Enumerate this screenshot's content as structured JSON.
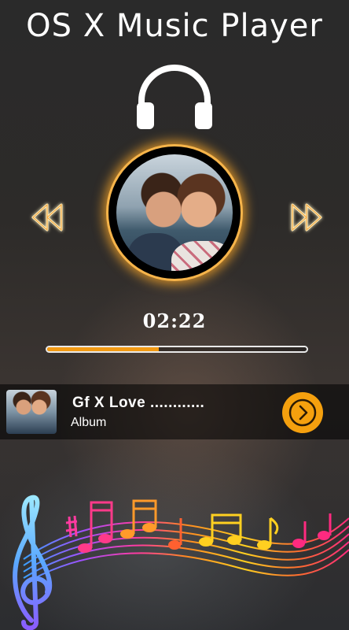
{
  "header": {
    "title": "OS X Music Player"
  },
  "player": {
    "time": "02:22",
    "progress_fraction": 0.43
  },
  "now_playing": {
    "title": "Gf X Love ............",
    "album": "Album"
  },
  "icons": {
    "headphones": "headphones-icon",
    "rewind": "rewind-icon",
    "fast_forward": "fast-forward-icon",
    "play": "play-circle-icon",
    "music_notes": "music-notes-decoration"
  },
  "colors": {
    "accent": "#f5a00e",
    "glow": "#f6b44a",
    "progress_fill": "#f29a14"
  }
}
